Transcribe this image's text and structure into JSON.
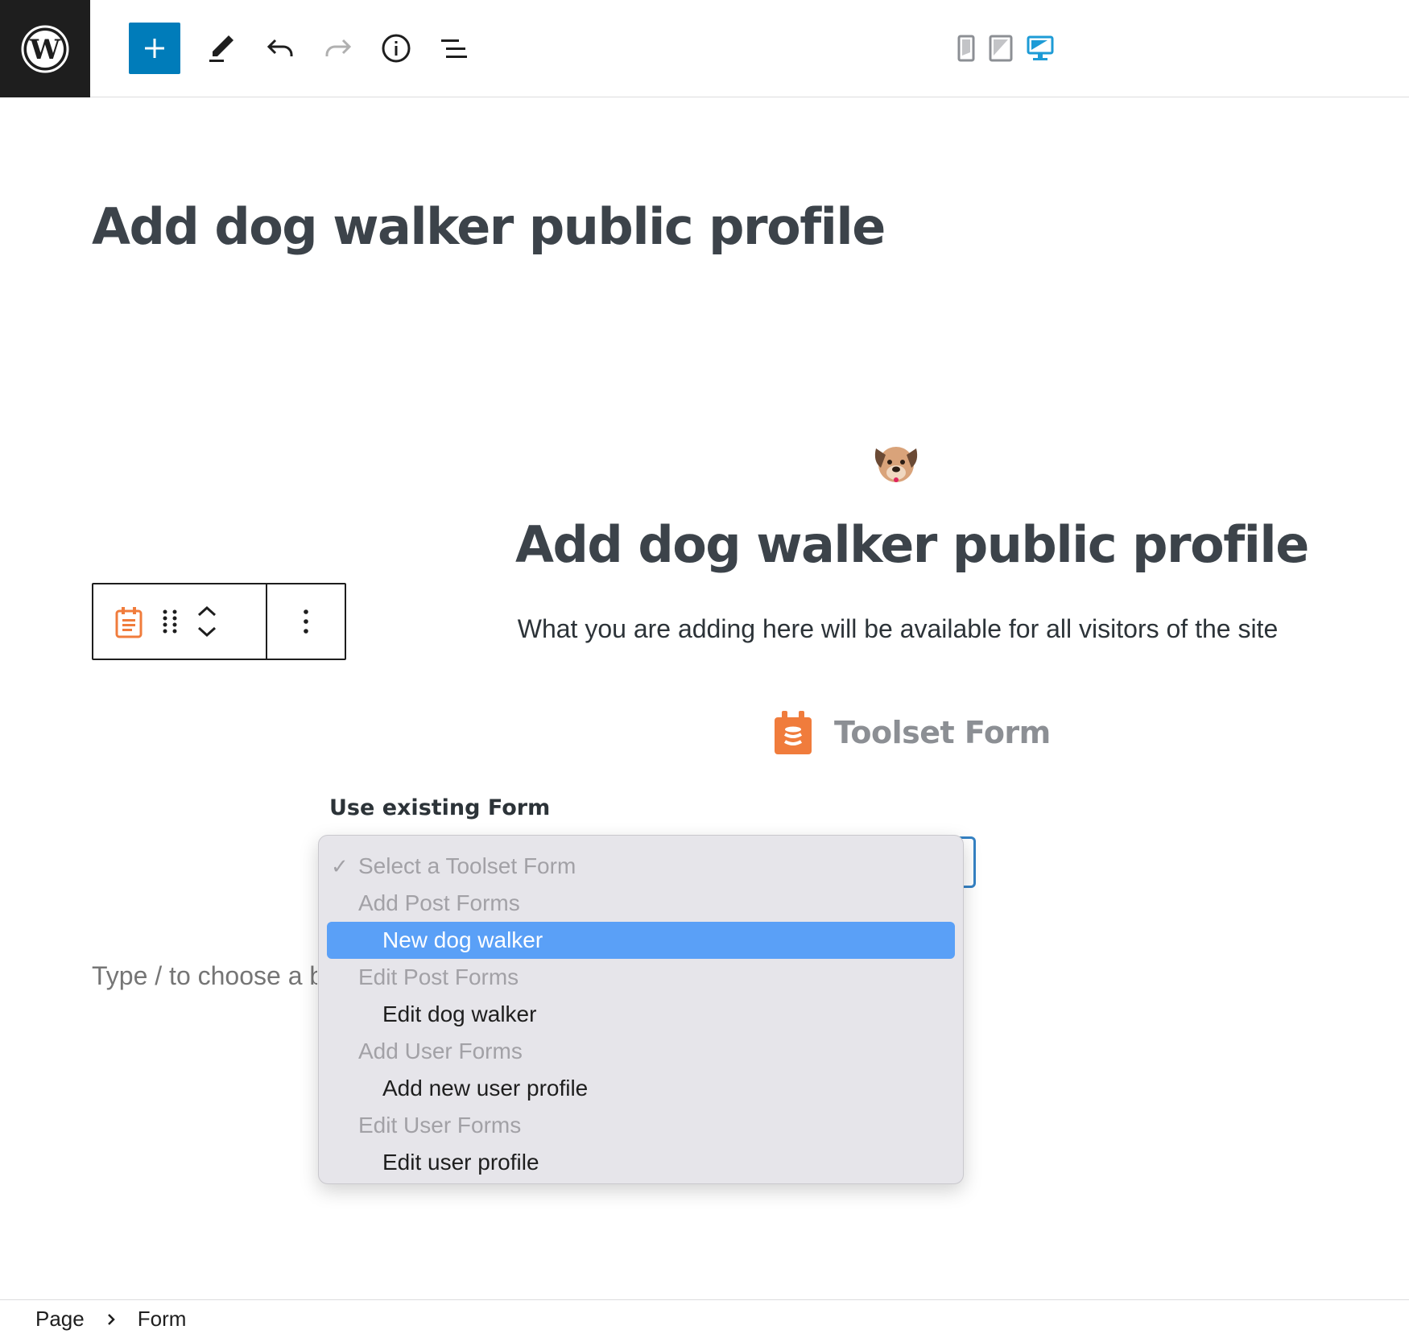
{
  "toolbar": {
    "logo_icon": "wordpress-logo-icon",
    "add_icon": "plus-icon",
    "tools_icon": "pencil-icon",
    "undo_icon": "undo-icon",
    "redo_icon": "redo-icon",
    "details_icon": "info-icon",
    "outline_icon": "list-view-icon",
    "preview_devices": [
      "mobile",
      "tablet",
      "desktop"
    ],
    "active_device": "desktop",
    "accent_color": "#007cba"
  },
  "post": {
    "title": "Add dog walker public profile"
  },
  "form_block": {
    "emoji_icon": "dog-face-icon",
    "heading": "Add dog walker public profile",
    "subheading": "What you are adding here will be available for all visitors of the site",
    "brand_title": "Toolset Form",
    "brand_icon": "toolset-form-icon",
    "brand_color": "#f07c3c",
    "use_existing_label": "Use existing Form"
  },
  "block_toolbar": {
    "block_icon": "toolset-form-icon",
    "drag_icon": "drag-handle-icon",
    "move_up_icon": "chevron-up-icon",
    "move_down_icon": "chevron-down-icon",
    "more_icon": "more-vertical-icon"
  },
  "placeholder": {
    "text": "Type / to choose a b"
  },
  "dropdown": {
    "selected": "Select a Toolset Form",
    "highlighted": "New dog walker",
    "rows": [
      {
        "type": "placeholder",
        "label": "Select a Toolset Form"
      },
      {
        "type": "group",
        "label": "Add Post Forms"
      },
      {
        "type": "option",
        "label": "New dog walker"
      },
      {
        "type": "group",
        "label": "Edit Post Forms"
      },
      {
        "type": "option",
        "label": "Edit dog walker"
      },
      {
        "type": "group",
        "label": "Add User Forms"
      },
      {
        "type": "option",
        "label": "Add new user profile"
      },
      {
        "type": "group",
        "label": "Edit User Forms"
      },
      {
        "type": "option",
        "label": "Edit user profile"
      }
    ],
    "highlight_color": "#5aa0f7"
  },
  "breadcrumb": {
    "items": [
      "Page",
      "Form"
    ]
  }
}
